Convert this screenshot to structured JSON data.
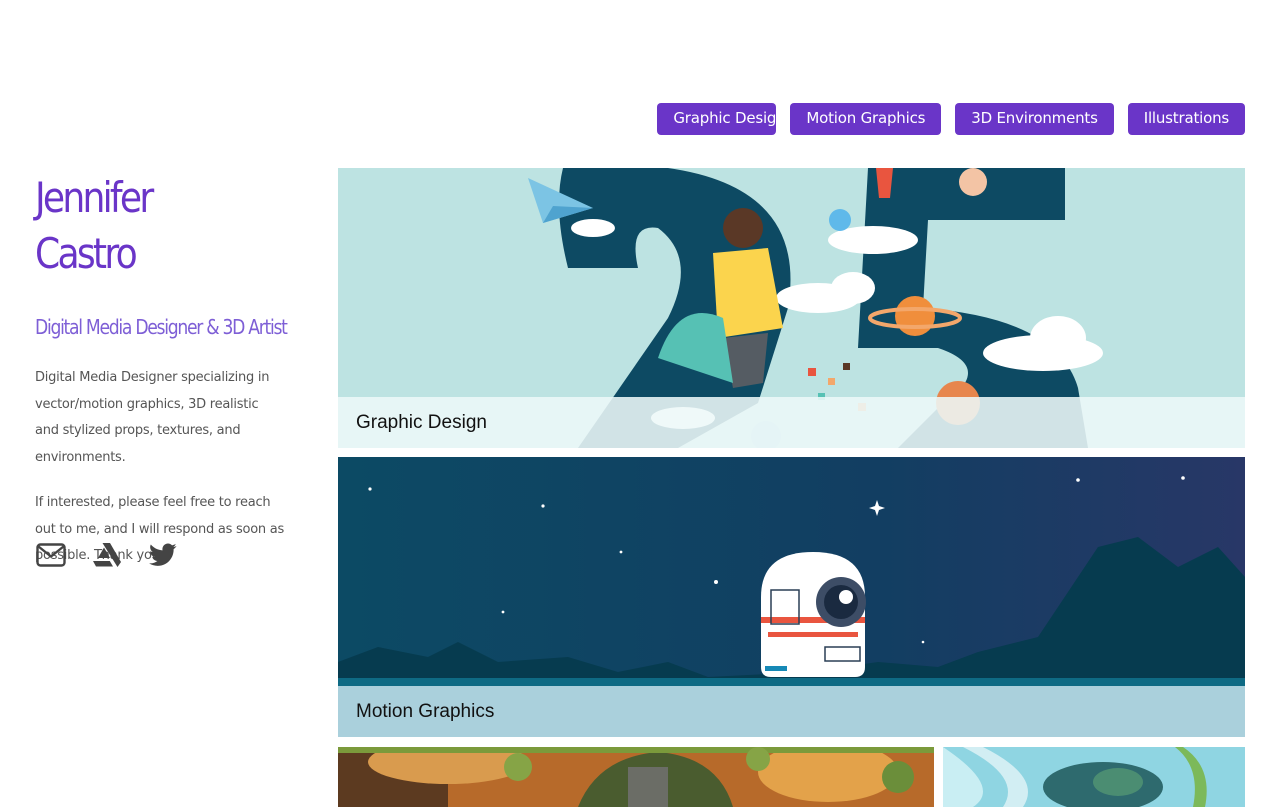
{
  "nav": {
    "items": [
      {
        "label": "Graphic Design"
      },
      {
        "label": "Motion Graphics"
      },
      {
        "label": "3D Environments"
      },
      {
        "label": "Illustrations"
      }
    ]
  },
  "profile": {
    "name": "Jennifer Castro",
    "tagline": "Digital Media Designer & 3D Artist",
    "bio": "Digital Media Designer specializing in vector/motion graphics, 3D realistic and stylized props, textures, and environments.",
    "contact_note": "If interested, please feel free to reach out to me, and I will respond as soon as possible. Thank you."
  },
  "social": {
    "icons": [
      "mail-icon",
      "artstation-icon",
      "twitter-icon"
    ]
  },
  "gallery": {
    "cards": [
      {
        "caption": "Graphic Design",
        "image": "25th anniversary illustration"
      },
      {
        "caption": "Motion Graphics",
        "image": "robot camera in night sky"
      },
      {
        "caption": "",
        "image": "3d environment interior"
      },
      {
        "caption": "",
        "image": "fantasy illustration"
      }
    ]
  },
  "colors": {
    "accent": "#6a35c8",
    "tagline": "#7e5fd6",
    "body_text": "#555555",
    "card1_bg": "#bde3e2",
    "card2_bg": "#0e4a63"
  }
}
